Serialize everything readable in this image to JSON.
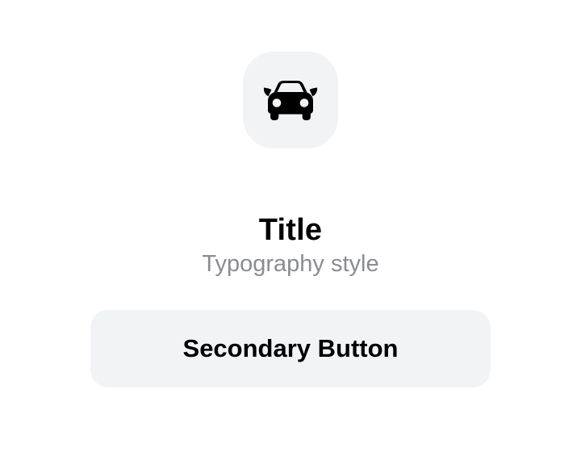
{
  "icon": {
    "name": "car-front-icon",
    "tile_color": "#f2f3f5",
    "glyph_color": "#000000"
  },
  "content": {
    "title": "Title",
    "subtitle": "Typography style"
  },
  "actions": {
    "secondary_button_label": "Secondary Button"
  },
  "colors": {
    "background": "#ffffff",
    "title": "#000000",
    "subtitle": "#8a8c91",
    "button_background": "#f2f3f5",
    "button_text": "#000000"
  }
}
